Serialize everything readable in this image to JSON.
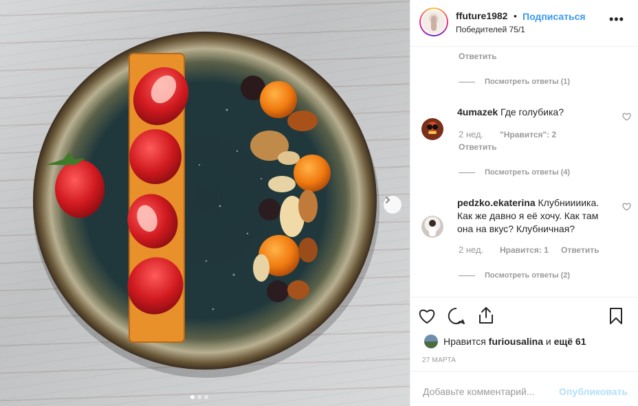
{
  "header": {
    "username": "ffuture1982",
    "separator": "•",
    "follow_label": "Подписаться",
    "location": "Победителей 75/1",
    "more_label": "•••"
  },
  "comments": {
    "partial_reply_label": "Ответить",
    "first_view_replies": "Посмотреть ответы (1)",
    "items": [
      {
        "user": "4umazek",
        "text": "Где голубика?",
        "age": "2 нед.",
        "likes": "\"Нравится\": 2",
        "reply": "Ответить",
        "view_replies": "Посмотреть ответы (4)"
      },
      {
        "user": "pedzko.ekaterina",
        "text_line1": "Клубниииика.",
        "text_line2": "Как же давно я её хочу. Как там",
        "text_line3": "она на вкус? Клубничная?",
        "age": "2 нед.",
        "likes": "Нравится: 1",
        "reply": "Ответить",
        "view_replies": "Посмотреть ответы (2)"
      }
    ]
  },
  "actions": {
    "likes_prefix": "Нравится",
    "likes_user": "furiousalina",
    "likes_mid": "и",
    "likes_more": "ещё 61",
    "date": "27 МАРТА"
  },
  "add_comment": {
    "placeholder": "Добавьте комментарий...",
    "publish_label": "Опубликовать"
  },
  "colors": {
    "link_blue": "#3897f0",
    "publish_disabled": "#b2dffc",
    "muted_text": "#999999"
  }
}
